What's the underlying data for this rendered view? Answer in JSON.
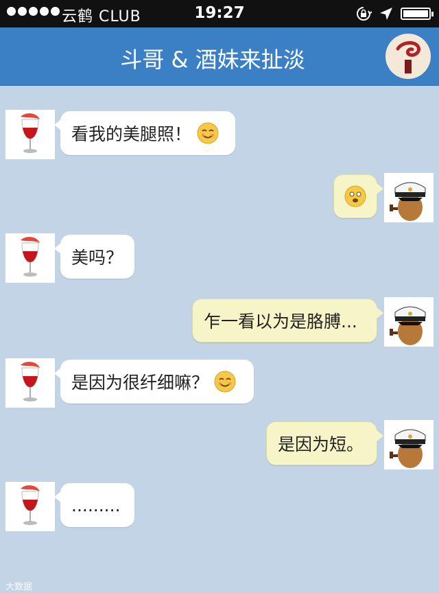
{
  "status_bar": {
    "carrier": "云鹤 CLUB",
    "time": "19:27",
    "signal_icon": "signal-dots-icon",
    "rotation_lock_icon": "rotation-lock-icon",
    "location_icon": "location-arrow-icon",
    "battery_icon": "battery-icon"
  },
  "nav": {
    "title": "斗哥 & 酒妹来扯淡",
    "group_avatar_icon": "pipe-logo-icon"
  },
  "messages": [
    {
      "side": "in",
      "sender_avatar": "wine-glass-avatar",
      "text": "看我的美腿照！",
      "emoji": "smiling-face-icon"
    },
    {
      "side": "out",
      "sender_avatar": "captain-egg-avatar",
      "text": "",
      "emoji": "shocked-face-icon"
    },
    {
      "side": "in",
      "sender_avatar": "wine-glass-avatar",
      "text": "美吗？",
      "emoji": ""
    },
    {
      "side": "out",
      "sender_avatar": "captain-egg-avatar",
      "text": "乍一看以为是胳膊...",
      "emoji": ""
    },
    {
      "side": "in",
      "sender_avatar": "wine-glass-avatar",
      "text": "是因为很纤细嘛？",
      "emoji": "smiling-face-icon"
    },
    {
      "side": "out",
      "sender_avatar": "captain-egg-avatar",
      "text": "是因为短。",
      "emoji": ""
    },
    {
      "side": "in",
      "sender_avatar": "wine-glass-avatar",
      "text": ".........",
      "emoji": ""
    }
  ],
  "watermark": "大数据"
}
